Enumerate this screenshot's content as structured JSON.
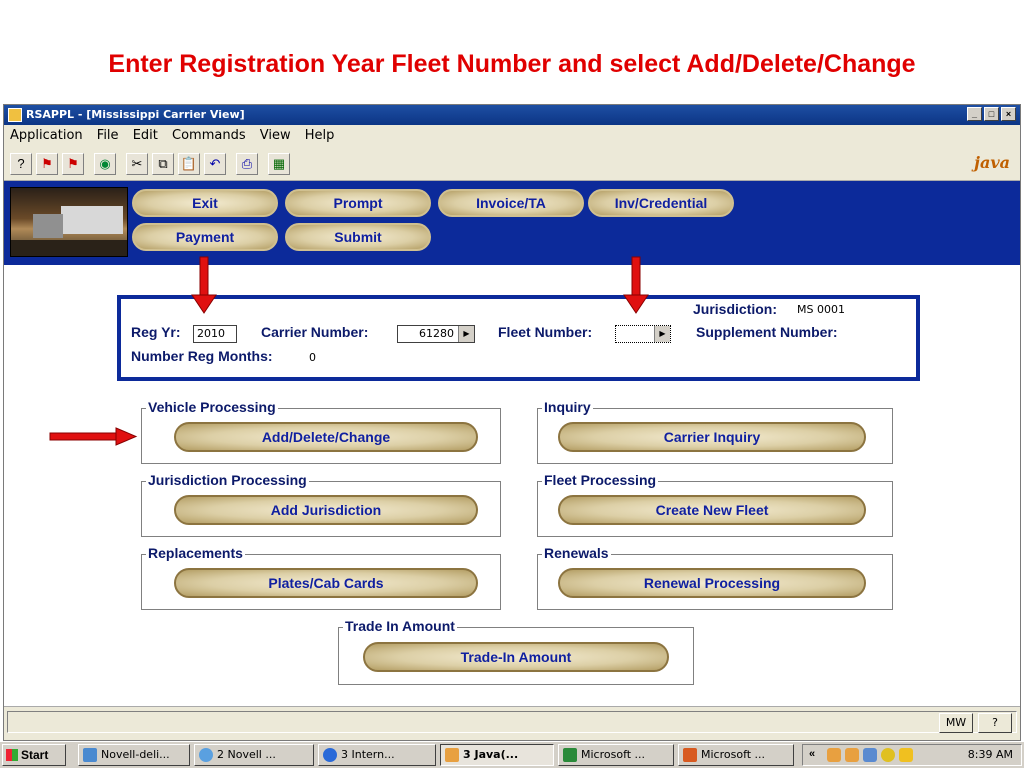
{
  "slide": {
    "title": "Enter Registration Year Fleet Number and select Add/Delete/Change"
  },
  "window": {
    "title": "RSAPPL - [Mississippi Carrier View]",
    "controls": [
      "_",
      "□",
      "×"
    ]
  },
  "menu": [
    "Application",
    "File",
    "Edit",
    "Commands",
    "View",
    "Help"
  ],
  "toolbar": {
    "icons": [
      "help-icon",
      "flag-red-icon",
      "flag-exclaim-icon",
      "eye-icon",
      "scissors-icon",
      "copy-icon",
      "paste-icon",
      "undo-icon",
      "print-icon",
      "calculator-icon"
    ],
    "glyphs": [
      "?",
      "⚑",
      "⚑",
      "◉",
      "✂",
      "⧉",
      "📋",
      "↶",
      "⎙",
      "▦"
    ],
    "brand": "java"
  },
  "band_buttons": {
    "exit": "Exit",
    "prompt": "Prompt",
    "invoice": "Invoice/TA",
    "credential": "Inv/Credential",
    "payment": "Payment",
    "submit": "Submit"
  },
  "header": {
    "jurisdiction_label": "Jurisdiction:",
    "jurisdiction_value": "MS 0001",
    "reg_yr_label": "Reg Yr:",
    "reg_yr_value": "2010",
    "carrier_label": "Carrier Number:",
    "carrier_value": "61280",
    "fleet_label": "Fleet Number:",
    "fleet_value": "",
    "supplement_label": "Supplement Number:",
    "reg_months_label": "Number Reg Months:",
    "reg_months_value": "0"
  },
  "groups": {
    "vehicle": {
      "title": "Vehicle Processing",
      "button": "Add/Delete/Change"
    },
    "inquiry": {
      "title": "Inquiry",
      "button": "Carrier Inquiry"
    },
    "jurisdiction": {
      "title": "Jurisdiction Processing",
      "button": "Add Jurisdiction"
    },
    "fleet": {
      "title": "Fleet Processing",
      "button": "Create New Fleet"
    },
    "replacements": {
      "title": "Replacements",
      "button": "Plates/Cab Cards"
    },
    "renewals": {
      "title": "Renewals",
      "button": "Renewal Processing"
    },
    "tradein": {
      "title": "Trade In Amount",
      "button": "Trade-In Amount"
    }
  },
  "status_bar": {
    "user": "MW",
    "help": "?"
  },
  "taskbar": {
    "start": "Start",
    "tasks": [
      "Novell-deli...",
      "2 Novell ...",
      "3 Intern...",
      "3 Java(...",
      "Microsoft ...",
      "Microsoft ..."
    ],
    "clock": "8:39 AM"
  },
  "colors": {
    "accent_red": "#e00000",
    "band_blue": "#0c2a9a",
    "label_navy": "#0c1a6a"
  }
}
